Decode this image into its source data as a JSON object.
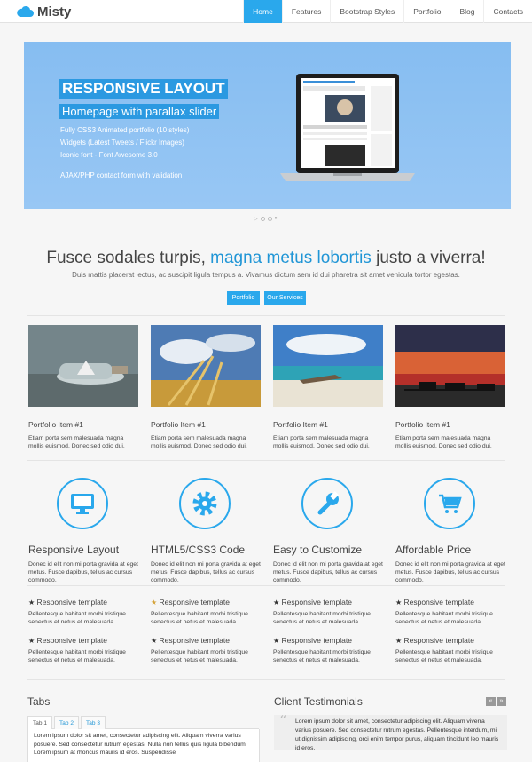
{
  "brand": {
    "name": "Misty",
    "accent": "#2aa8ec"
  },
  "nav": {
    "items": [
      "Home",
      "Features",
      "Bootstrap Styles",
      "Portfolio",
      "Blog",
      "Contacts"
    ]
  },
  "hero": {
    "title": "RESPONSIVE LAYOUT",
    "subtitle": "Homepage with parallax slider",
    "features": [
      "Fully CSS3 Animated portfolio (10 styles)",
      "Widgets (Latest Tweets / Flickr Images)",
      "Iconic font - Font Awesome 3.0",
      "AJAX/PHP contact form with validation"
    ]
  },
  "intro": {
    "heading_start": "Fusce sodales turpis, ",
    "heading_highlight": "magna metus lobortis",
    "heading_end": " justo a viverra!",
    "subheading": "Duis mattis placerat lectus, ac suscipit ligula tempus a. Vivamus dictum sem id dui pharetra sit amet vehicula tortor egestas.",
    "buttons": [
      "Portfolio",
      "Our Services"
    ]
  },
  "portfolio": [
    {
      "title": "Portfolio Item #1",
      "text": "Etiam porta sem malesuada magna mollis euismod. Donec sed odio dui."
    },
    {
      "title": "Portfolio Item #1",
      "text": "Etiam porta sem malesuada magna mollis euismod. Donec sed odio dui."
    },
    {
      "title": "Portfolio Item #1",
      "text": "Etiam porta sem malesuada magna mollis euismod. Donec sed odio dui."
    },
    {
      "title": "Portfolio Item #1",
      "text": "Etiam porta sem malesuada magna mollis euismod. Donec sed odio dui."
    }
  ],
  "features": [
    {
      "icon": "monitor-icon",
      "title": "Responsive Layout",
      "text": "Donec id elit non mi porta gravida at eget metus. Fusce dapibus, tellus ac cursus commodo."
    },
    {
      "icon": "gear-icon",
      "title": "HTML5/CSS3 Code",
      "text": "Donec id elit non mi porta gravida at eget metus. Fusce dapibus, tellus ac cursus commodo."
    },
    {
      "icon": "wrench-icon",
      "title": "Easy to Customize",
      "text": "Donec id elit non mi porta gravida at eget metus. Fusce dapibus, tellus ac cursus commodo."
    },
    {
      "icon": "cart-icon",
      "title": "Affordable Price",
      "text": "Donec id elit non mi porta gravida at eget metus. Fusce dapibus, tellus ac cursus commodo."
    }
  ],
  "templates": {
    "title": "Responsive template",
    "text": "Pellentesque habitant morbi tristique senectus et netus et malesuada."
  },
  "tabs": {
    "heading": "Tabs",
    "labels": [
      "Tab 1",
      "Tab 2",
      "Tab 3"
    ],
    "body": "Lorem ipsum dolor sit amet, consectetur adipiscing elit. Aliquam viverra varius posuere. Sed consectetur rutrum egestas. Nulla non tellus quis ligula bibendum. Lorem ipsum at rhoncus mauris id eros. Suspendisse"
  },
  "testimonials": {
    "heading": "Client Testimonials",
    "prev": "«",
    "next": "»",
    "quote": "Lorem ipsum dolor sit amet, consectetur adipiscing elit. Aliquam viverra varius posuere. Sed consectetur rutrum egestas. Pellentesque interdum, mi ut dignissim adipiscing, orci enim tempor purus, aliquam tincidunt leo mauris id eros."
  }
}
